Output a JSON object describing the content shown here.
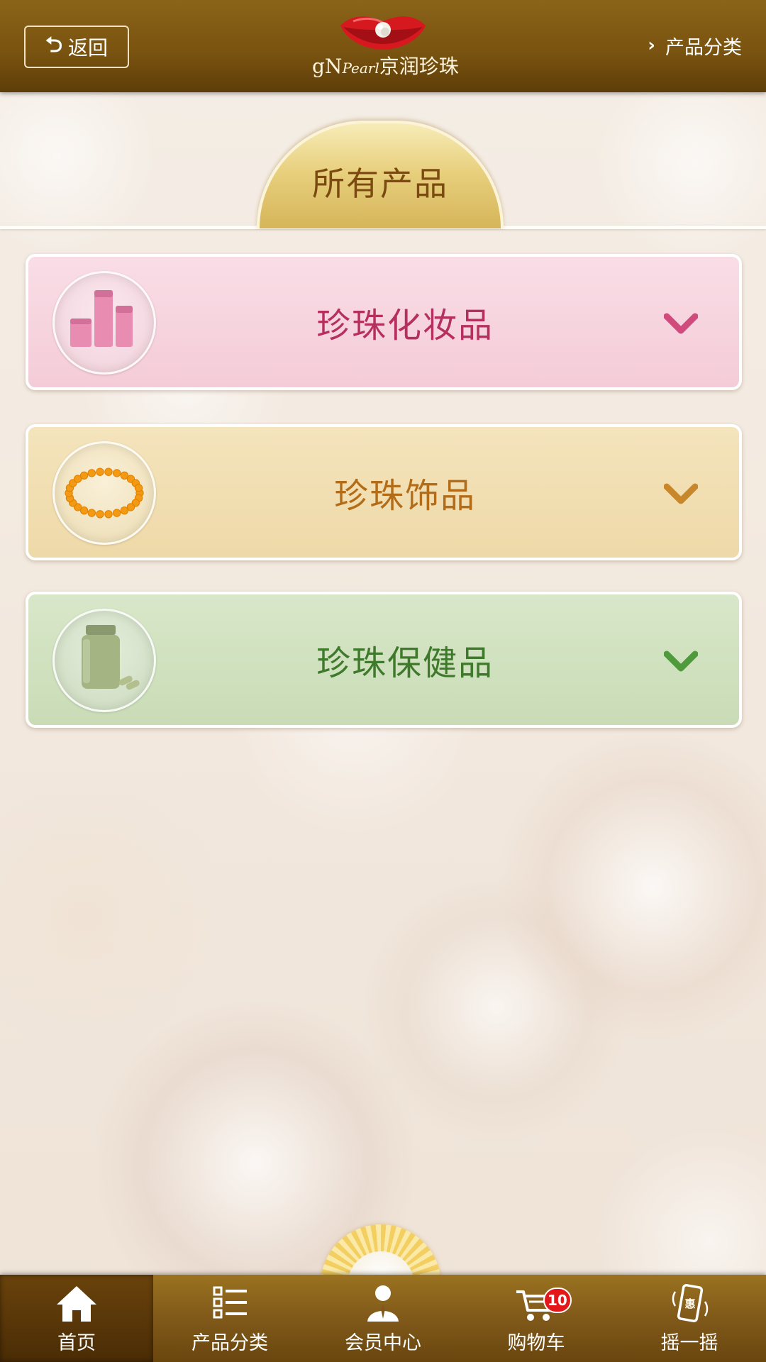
{
  "header": {
    "back_label": "返回",
    "logo_brand_prefix": "gN",
    "logo_brand_pearl": "Pearl",
    "logo_brand_name": "京润珍珠",
    "category_link_label": "产品分类"
  },
  "section": {
    "title": "所有产品"
  },
  "categories": [
    {
      "label": "珍珠化妆品",
      "accent": "#d04a7c",
      "icon": "cosmetics-bottles-icon"
    },
    {
      "label": "珍珠饰品",
      "accent": "#c8872a",
      "icon": "pearl-necklace-icon"
    },
    {
      "label": "珍珠保健品",
      "accent": "#4f9a3a",
      "icon": "supplement-bottle-icon"
    }
  ],
  "scroll_top_icon": "chevron-up-icon",
  "tabbar": {
    "items": [
      {
        "label": "首页",
        "icon": "home-icon",
        "active": true
      },
      {
        "label": "产品分类",
        "icon": "category-list-icon",
        "active": false
      },
      {
        "label": "会员中心",
        "icon": "member-icon",
        "active": false
      },
      {
        "label": "购物车",
        "icon": "cart-icon",
        "active": false,
        "badge": "10"
      },
      {
        "label": "摇一摇",
        "icon": "shake-phone-icon",
        "active": false,
        "icon_text": "惠"
      }
    ]
  },
  "colors": {
    "header_brown": "#7a5410",
    "gold": "#d6b55a",
    "badge_red": "#e3171a"
  }
}
